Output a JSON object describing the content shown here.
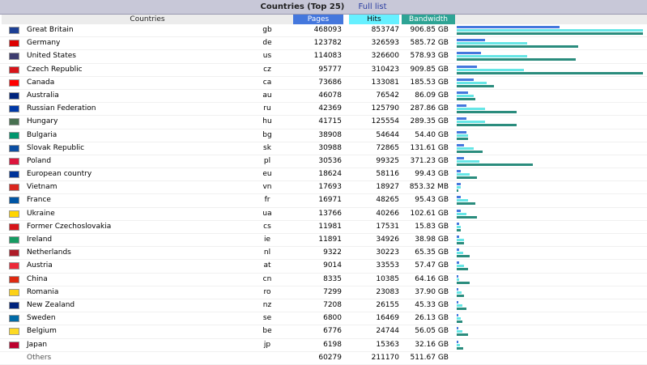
{
  "header": {
    "title": "Countries (Top 25)",
    "full_list": "Full list"
  },
  "columns": {
    "countries": "Countries",
    "pages": "Pages",
    "hits": "Hits",
    "bandwidth": "Bandwidth"
  },
  "colors": {
    "pages": "#4477dd",
    "hits": "#66f0ff",
    "bandwidth": "#2ea495"
  },
  "rows": [
    {
      "flag": "gb-flag-icon",
      "country": "Great Britain",
      "code": "gb",
      "pages": "468093",
      "hits": "853747",
      "bandwidth": "906.85 GB",
      "p": 0.55,
      "h": 1.0,
      "b": 1.0
    },
    {
      "flag": "de-flag-icon",
      "country": "Germany",
      "code": "de",
      "pages": "123782",
      "hits": "326593",
      "bandwidth": "585.72 GB",
      "p": 0.15,
      "h": 0.38,
      "b": 0.65
    },
    {
      "flag": "us-flag-icon",
      "country": "United States",
      "code": "us",
      "pages": "114083",
      "hits": "326600",
      "bandwidth": "578.93 GB",
      "p": 0.13,
      "h": 0.38,
      "b": 0.64
    },
    {
      "flag": "cz-flag-icon",
      "country": "Czech Republic",
      "code": "cz",
      "pages": "95777",
      "hits": "310423",
      "bandwidth": "909.85 GB",
      "p": 0.11,
      "h": 0.36,
      "b": 1.0
    },
    {
      "flag": "ca-flag-icon",
      "country": "Canada",
      "code": "ca",
      "pages": "73686",
      "hits": "133081",
      "bandwidth": "185.53 GB",
      "p": 0.09,
      "h": 0.16,
      "b": 0.2
    },
    {
      "flag": "au-flag-icon",
      "country": "Australia",
      "code": "au",
      "pages": "46078",
      "hits": "76542",
      "bandwidth": "86.09 GB",
      "p": 0.06,
      "h": 0.09,
      "b": 0.1
    },
    {
      "flag": "ru-flag-icon",
      "country": "Russian Federation",
      "code": "ru",
      "pages": "42369",
      "hits": "125790",
      "bandwidth": "287.86 GB",
      "p": 0.05,
      "h": 0.15,
      "b": 0.32
    },
    {
      "flag": "hu-flag-icon",
      "country": "Hungary",
      "code": "hu",
      "pages": "41715",
      "hits": "125554",
      "bandwidth": "289.35 GB",
      "p": 0.05,
      "h": 0.15,
      "b": 0.32
    },
    {
      "flag": "bg-flag-icon",
      "country": "Bulgaria",
      "code": "bg",
      "pages": "38908",
      "hits": "54644",
      "bandwidth": "54.40 GB",
      "p": 0.05,
      "h": 0.06,
      "b": 0.06
    },
    {
      "flag": "sk-flag-icon",
      "country": "Slovak Republic",
      "code": "sk",
      "pages": "30988",
      "hits": "72865",
      "bandwidth": "131.61 GB",
      "p": 0.04,
      "h": 0.09,
      "b": 0.14
    },
    {
      "flag": "pl-flag-icon",
      "country": "Poland",
      "code": "pl",
      "pages": "30536",
      "hits": "99325",
      "bandwidth": "371.23 GB",
      "p": 0.04,
      "h": 0.12,
      "b": 0.41
    },
    {
      "flag": "eu-flag-icon",
      "country": "European country",
      "code": "eu",
      "pages": "18624",
      "hits": "58116",
      "bandwidth": "99.43 GB",
      "p": 0.02,
      "h": 0.07,
      "b": 0.11
    },
    {
      "flag": "vn-flag-icon",
      "country": "Vietnam",
      "code": "vn",
      "pages": "17693",
      "hits": "18927",
      "bandwidth": "853.32 MB",
      "p": 0.02,
      "h": 0.02,
      "b": 0.01
    },
    {
      "flag": "fr-flag-icon",
      "country": "France",
      "code": "fr",
      "pages": "16971",
      "hits": "48265",
      "bandwidth": "95.43 GB",
      "p": 0.02,
      "h": 0.06,
      "b": 0.1
    },
    {
      "flag": "ua-flag-icon",
      "country": "Ukraine",
      "code": "ua",
      "pages": "13766",
      "hits": "40266",
      "bandwidth": "102.61 GB",
      "p": 0.02,
      "h": 0.05,
      "b": 0.11
    },
    {
      "flag": "cs-flag-icon",
      "country": "Former Czechoslovakia",
      "code": "cs",
      "pages": "11981",
      "hits": "17531",
      "bandwidth": "15.83 GB",
      "p": 0.015,
      "h": 0.02,
      "b": 0.02
    },
    {
      "flag": "ie-flag-icon",
      "country": "Ireland",
      "code": "ie",
      "pages": "11891",
      "hits": "34926",
      "bandwidth": "38.98 GB",
      "p": 0.015,
      "h": 0.04,
      "b": 0.04
    },
    {
      "flag": "nl-flag-icon",
      "country": "Netherlands",
      "code": "nl",
      "pages": "9322",
      "hits": "30223",
      "bandwidth": "65.35 GB",
      "p": 0.012,
      "h": 0.035,
      "b": 0.07
    },
    {
      "flag": "at-flag-icon",
      "country": "Austria",
      "code": "at",
      "pages": "9014",
      "hits": "33553",
      "bandwidth": "57.47 GB",
      "p": 0.012,
      "h": 0.04,
      "b": 0.06
    },
    {
      "flag": "cn-flag-icon",
      "country": "China",
      "code": "cn",
      "pages": "8335",
      "hits": "10385",
      "bandwidth": "64.16 GB",
      "p": 0.01,
      "h": 0.012,
      "b": 0.07
    },
    {
      "flag": "ro-flag-icon",
      "country": "Romania",
      "code": "ro",
      "pages": "7299",
      "hits": "23083",
      "bandwidth": "37.90 GB",
      "p": 0.01,
      "h": 0.027,
      "b": 0.04
    },
    {
      "flag": "nz-flag-icon",
      "country": "New Zealand",
      "code": "nz",
      "pages": "7208",
      "hits": "26155",
      "bandwidth": "45.33 GB",
      "p": 0.01,
      "h": 0.03,
      "b": 0.05
    },
    {
      "flag": "se-flag-icon",
      "country": "Sweden",
      "code": "se",
      "pages": "6800",
      "hits": "16469",
      "bandwidth": "26.13 GB",
      "p": 0.008,
      "h": 0.02,
      "b": 0.03
    },
    {
      "flag": "be-flag-icon",
      "country": "Belgium",
      "code": "be",
      "pages": "6776",
      "hits": "24744",
      "bandwidth": "56.05 GB",
      "p": 0.008,
      "h": 0.03,
      "b": 0.06
    },
    {
      "flag": "jp-flag-icon",
      "country": "Japan",
      "code": "jp",
      "pages": "6198",
      "hits": "15363",
      "bandwidth": "32.16 GB",
      "p": 0.007,
      "h": 0.018,
      "b": 0.035
    }
  ],
  "others": {
    "country": "Others",
    "pages": "60279",
    "hits": "211170",
    "bandwidth": "511.67 GB"
  },
  "flag_colors": {
    "gb": "#1c3f94",
    "de": "#dd0000",
    "us": "#3c3b6e",
    "cz": "#d7141a",
    "ca": "#ff0000",
    "au": "#00247d",
    "ru": "#0039a6",
    "hu": "#477050",
    "bg": "#00966e",
    "sk": "#0b4ea2",
    "pl": "#dc143c",
    "eu": "#003399",
    "vn": "#da251d",
    "fr": "#0055a4",
    "ua": "#ffd500",
    "cs": "#d7141a",
    "ie": "#169b62",
    "nl": "#ae1c28",
    "at": "#ed2939",
    "cn": "#de2910",
    "ro": "#fcd116",
    "nz": "#00247d",
    "se": "#006aa7",
    "be": "#fdda24",
    "jp": "#bc002d"
  }
}
